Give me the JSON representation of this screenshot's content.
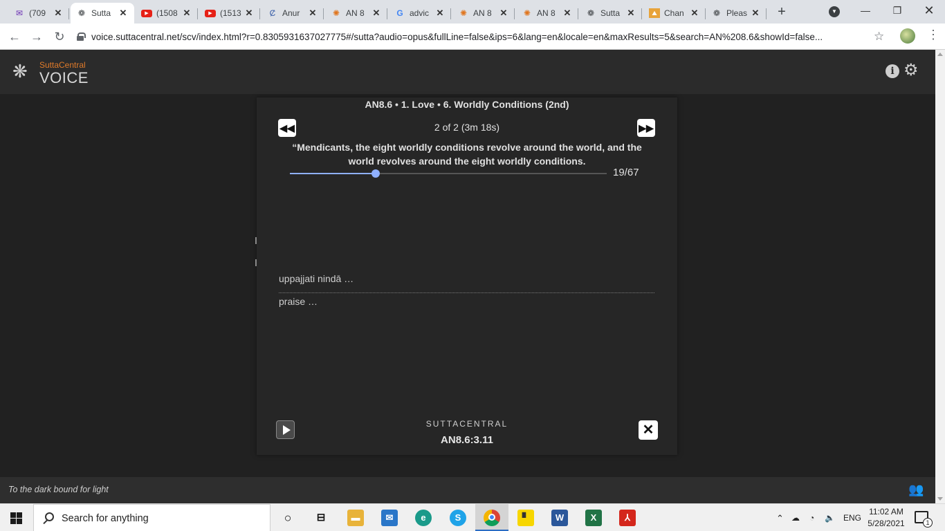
{
  "browser": {
    "tabs": [
      {
        "title": "(709",
        "icon": "mail-icon"
      },
      {
        "title": "Sutta",
        "icon": "dharma-wheel-icon"
      },
      {
        "title": "(1508",
        "icon": "youtube-icon"
      },
      {
        "title": "(1513",
        "icon": "youtube-icon"
      },
      {
        "title": "Anur",
        "icon": "site-icon"
      },
      {
        "title": "AN 8",
        "icon": "dharma-wheel-icon"
      },
      {
        "title": "advic",
        "icon": "google-icon"
      },
      {
        "title": "AN 8",
        "icon": "dharma-wheel-icon"
      },
      {
        "title": "AN 8",
        "icon": "dharma-wheel-icon"
      },
      {
        "title": "Sutta",
        "icon": "dharma-wheel-icon"
      },
      {
        "title": "Chan",
        "icon": "site-icon"
      },
      {
        "title": "Pleas",
        "icon": "dharma-wheel-icon"
      }
    ],
    "active_tab": 1,
    "url": "voice.suttacentral.net/scv/index.html?r=0.8305931637027775#/sutta?audio=opus&fullLine=false&ips=6&lang=en&locale=en&maxResults=5&search=AN%208.6&showId=false..."
  },
  "app": {
    "brand_small": "SuttaCentral",
    "brand_big": "VOICE",
    "footer_text": "To the dark bound for light"
  },
  "player": {
    "title": "AN8.6 • 1. Love • 6. Worldly Conditions (2nd)",
    "count": "2 of 2 (3m 18s)",
    "quote": "“Mendicants, the eight worldly conditions revolve around the world, and the world revolves around the eight worldly conditions.",
    "progress_label": "19/67",
    "progress_fraction": 0.27,
    "pali_line": "uppajjati nindā …",
    "english_line": "praise …",
    "brand": "SUTTACENTRAL",
    "ref": "AN8.6:3.11",
    "accent": "#8fb0ff"
  },
  "taskbar": {
    "search_placeholder": "Search for anything",
    "lang": "ENG",
    "time": "11:02 AM",
    "date": "5/28/2021",
    "notifications": "1"
  }
}
